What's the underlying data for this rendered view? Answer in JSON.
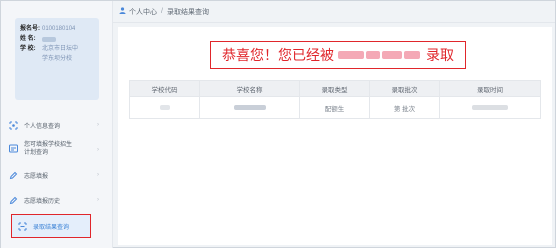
{
  "breadcrumb": {
    "home": "个人中心",
    "separator": "/",
    "current": "录取结果查询"
  },
  "user": {
    "exam_no_label": "报名号:",
    "exam_no_value": "0100180104",
    "name_label": "姓  名:",
    "school_label": "学  校:",
    "school_line1": "北京市日坛中",
    "school_line2": "学东坝分校"
  },
  "menu": [
    {
      "label": "个人信息查询",
      "icon": "user-icon"
    },
    {
      "label1": "您可填报学校招生",
      "label2": "计划查询",
      "icon": "plan-icon"
    },
    {
      "label": "志愿填报",
      "icon": "pencil-icon"
    },
    {
      "label": "志愿填报历史",
      "icon": "history-icon"
    },
    {
      "label": "录取结果查询",
      "icon": "result-icon",
      "active": true
    }
  ],
  "banner": {
    "prefix": "恭喜您！您已经被",
    "suffix": "录取"
  },
  "table": {
    "headers": [
      "学校代码",
      "学校名称",
      "录取类型",
      "录取批次",
      "录取时间"
    ],
    "row": {
      "type": "配额生",
      "batch": "第 批次"
    }
  },
  "colors": {
    "accent": "#4a88da",
    "highlight": "#e0262b"
  }
}
